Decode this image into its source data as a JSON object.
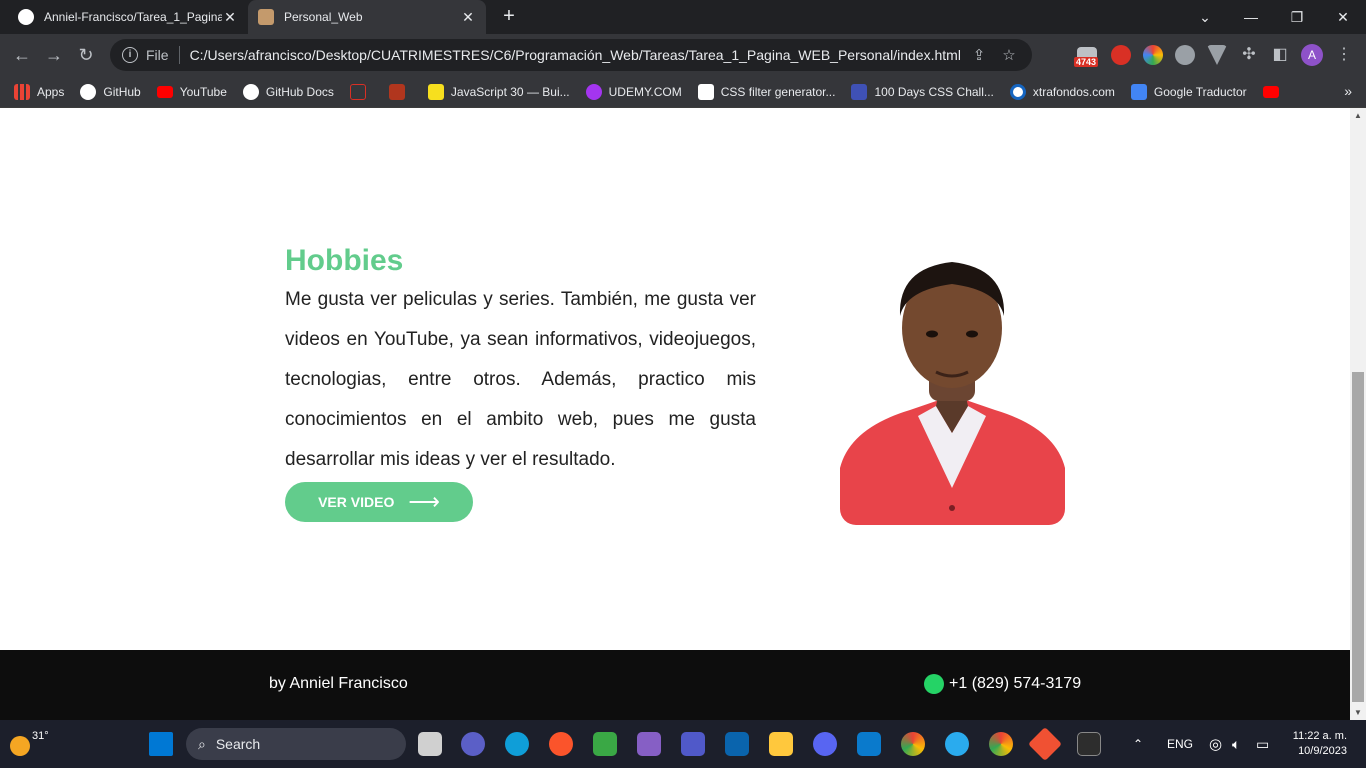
{
  "browser": {
    "tabs": [
      {
        "title": "Anniel-Francisco/Tarea_1_Pagina_",
        "active": false
      },
      {
        "title": "Personal_Web",
        "active": true
      }
    ],
    "address": {
      "scheme": "File",
      "url": "C:/Users/afrancisco/Desktop/CUATRIMESTRES/C6/Programación_Web/Tareas/Tarea_1_Pagina_WEB_Personal/index.html"
    },
    "extension_badge": "4743",
    "profile_initial": "A",
    "bookmarks": [
      {
        "label": "Apps",
        "icon": "apps-grid-icon"
      },
      {
        "label": "GitHub",
        "icon": "github-icon"
      },
      {
        "label": "YouTube",
        "icon": "youtube-icon"
      },
      {
        "label": "GitHub Docs",
        "icon": "github-icon"
      },
      {
        "label": "",
        "icon": "code-icon"
      },
      {
        "label": "",
        "icon": "codewars-icon"
      },
      {
        "label": "JavaScript 30 — Bui...",
        "icon": "js30-icon"
      },
      {
        "label": "UDEMY.COM",
        "icon": "udemy-icon"
      },
      {
        "label": "CSS filter generator...",
        "icon": "codepen-icon"
      },
      {
        "label": "100 Days CSS Chall...",
        "icon": "css-challenge-icon"
      },
      {
        "label": "xtrafondos.com",
        "icon": "eye-icon"
      },
      {
        "label": "Google Traductor",
        "icon": "google-translate-icon"
      },
      {
        "label": "",
        "icon": "youtube-icon"
      }
    ]
  },
  "page": {
    "hobbies": {
      "title": "Hobbies",
      "text": "Me gusta ver peliculas y series. También, me gusta ver videos en YouTube, ya sean informativos, videojuegos, tecnologias, entre otros. Además, practico mis conocimientos en el ambito web, pues me gusta desarrollar mis ideas y ver el resultado.",
      "button": "VER VIDEO"
    },
    "footer": {
      "author": "by Anniel Francisco",
      "phone": "+1 (829) 574-3179"
    }
  },
  "taskbar": {
    "temperature": "31°",
    "search_placeholder": "Search",
    "language": "ENG",
    "time": "11:22 a. m.",
    "date": "10/9/2023"
  },
  "colors": {
    "accent": "#62cc8c",
    "footer_bg": "#0d0d0d",
    "chrome_dark": "#202124",
    "chrome_toolbar": "#35363a"
  }
}
